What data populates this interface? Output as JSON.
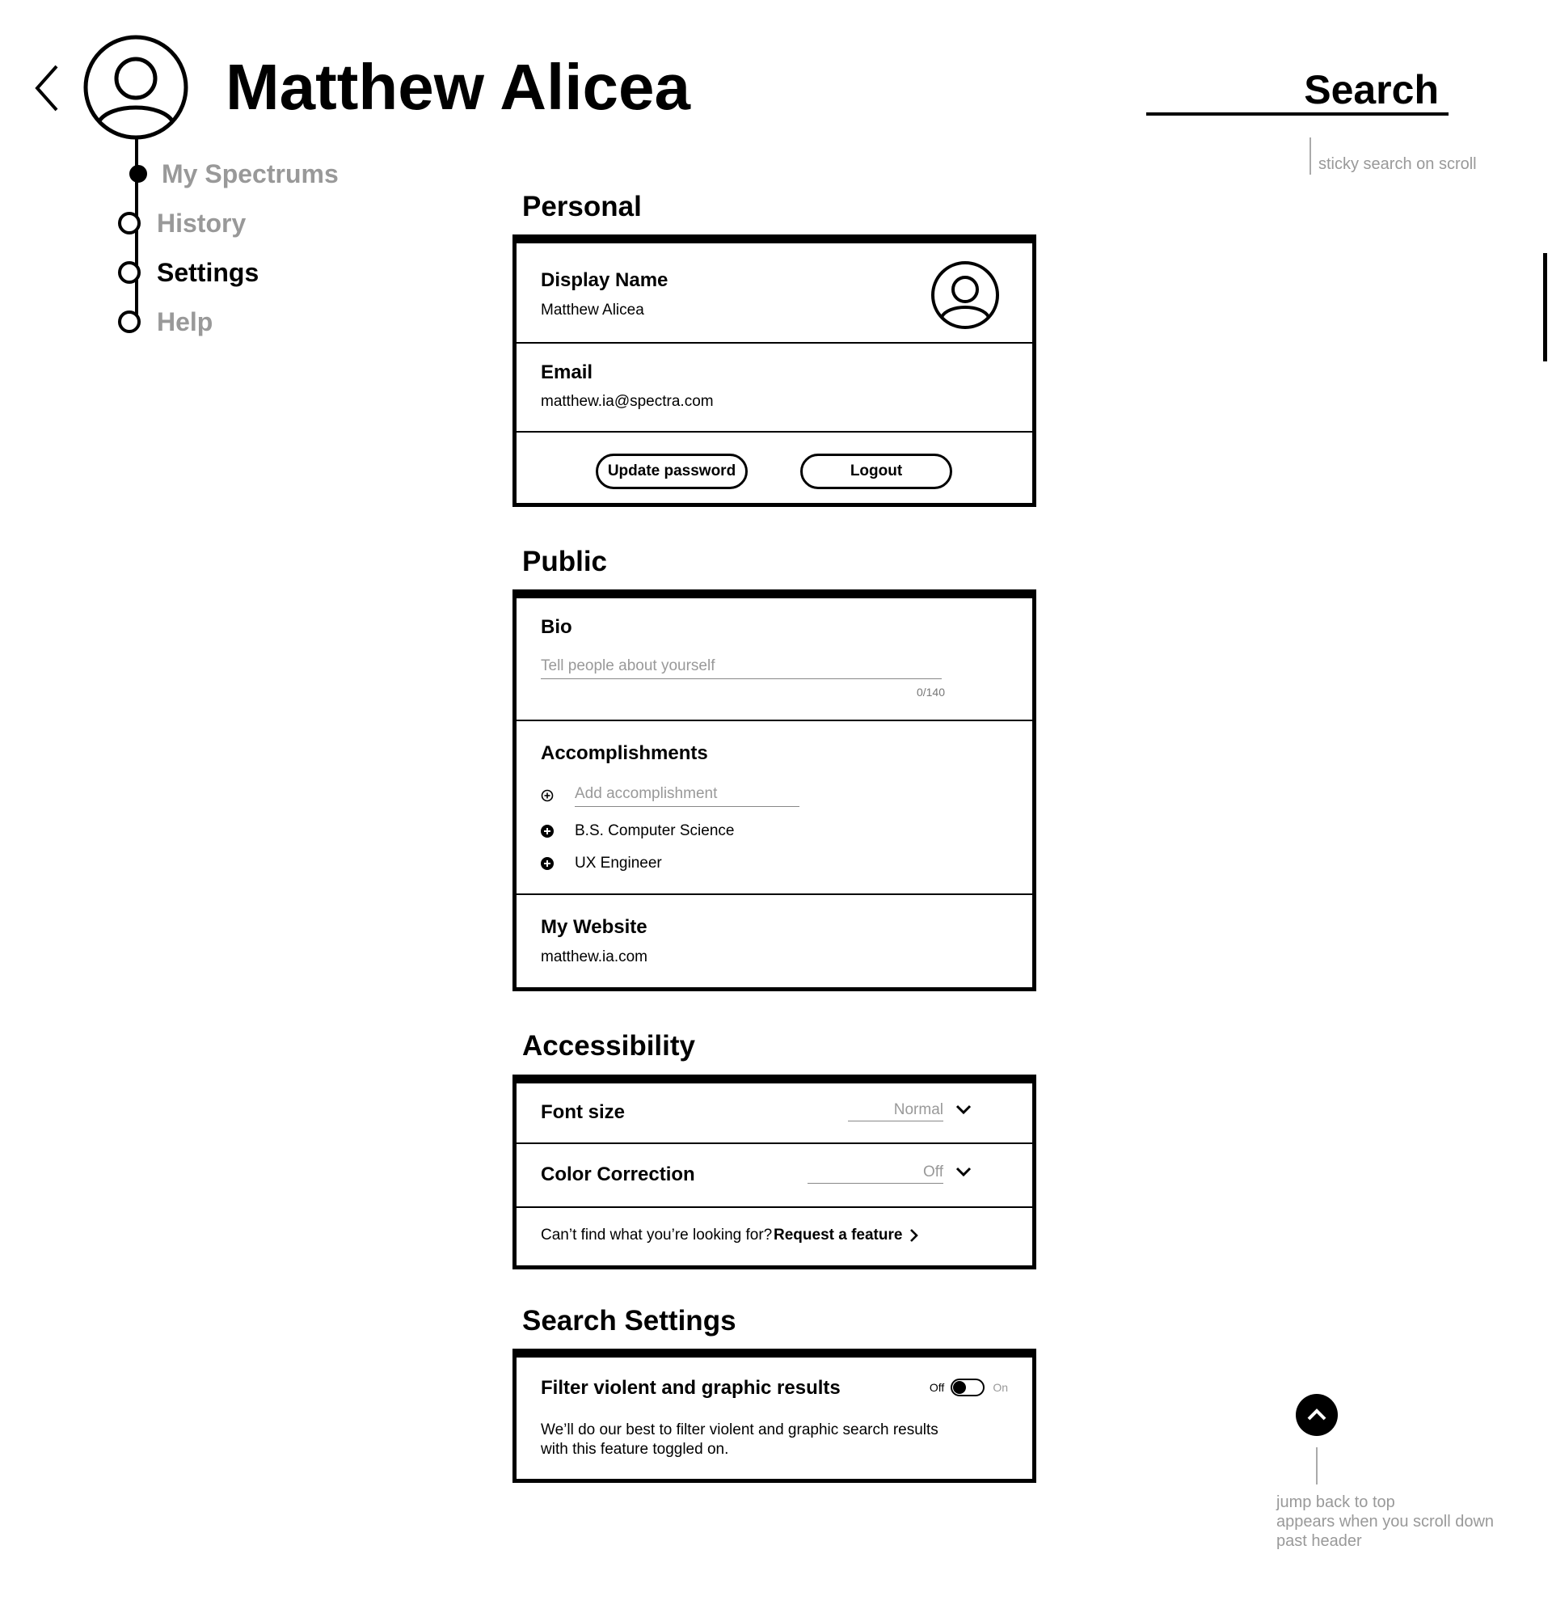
{
  "header": {
    "user_name": "Matthew Alicea",
    "back_icon": "chevron-left-icon",
    "avatar_icon": "user-avatar-icon"
  },
  "nav": {
    "items": [
      {
        "label": "My Spectrums",
        "active": false,
        "marker": "current-position"
      },
      {
        "label": "History",
        "active": false
      },
      {
        "label": "Settings",
        "active": true
      },
      {
        "label": "Help",
        "active": false
      }
    ]
  },
  "search": {
    "label": "Search",
    "note": "sticky search on scroll"
  },
  "personal": {
    "title": "Personal",
    "display_name_label": "Display Name",
    "display_name_value": "Matthew Alicea",
    "email_label": "Email",
    "email_value": "matthew.ia@spectra.com",
    "update_password_label": "Update password",
    "logout_label": "Logout"
  },
  "public": {
    "title": "Public",
    "bio_label": "Bio",
    "bio_placeholder": "Tell people about yourself",
    "bio_counter": "0/140",
    "accomplishments_label": "Accomplishments",
    "add_accomplishment_placeholder": "Add accomplishment",
    "accomplishments": [
      "B.S. Computer Science",
      "UX Engineer"
    ],
    "website_label": "My Website",
    "website_value": "matthew.ia.com"
  },
  "accessibility": {
    "title": "Accessibility",
    "font_size_label": "Font size",
    "font_size_value": "Normal",
    "color_correction_label": "Color Correction",
    "color_correction_value": "Off",
    "cant_find_text": "Can’t find what you’re looking for?",
    "request_feature_label": "Request a feature"
  },
  "search_settings": {
    "title": "Search Settings",
    "filter_label": "Filter violent and graphic results",
    "toggle_off_label": "Off",
    "toggle_on_label": "On",
    "toggle_state": "off",
    "filter_description_1": "We’ll do our best to filter violent and graphic search results",
    "filter_description_2": "with this feature toggled on."
  },
  "jump_top": {
    "icon": "chevron-up-icon",
    "note_1": "jump back to top",
    "note_2": "appears when you scroll down",
    "note_3": "past header"
  },
  "colors": {
    "ink": "#000000",
    "muted_text": "#999999",
    "background": "#ffffff"
  }
}
